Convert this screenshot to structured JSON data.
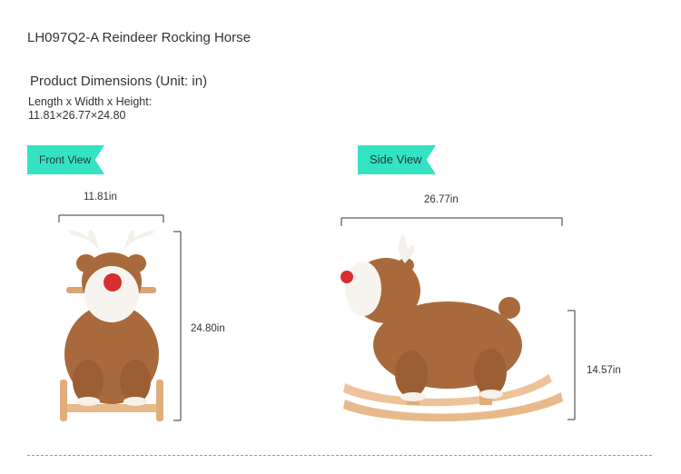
{
  "product": {
    "title": "LH097Q2-A Reindeer Rocking Horse",
    "dimensions_heading": "Product Dimensions (Unit: in)",
    "dimensions_label": "Length x Width x Height:",
    "dimensions_value": "11.81×26.77×24.80"
  },
  "views": {
    "front": {
      "label": "Front View",
      "width": "11.81in",
      "height": "24.80in"
    },
    "side": {
      "label": "Side View",
      "length": "26.77in",
      "seat_height": "14.57in"
    }
  },
  "colors": {
    "tag": "#34e3c4",
    "fur": "#a86a3c",
    "nose": "#d3302f",
    "wood": "#e8b98a"
  }
}
